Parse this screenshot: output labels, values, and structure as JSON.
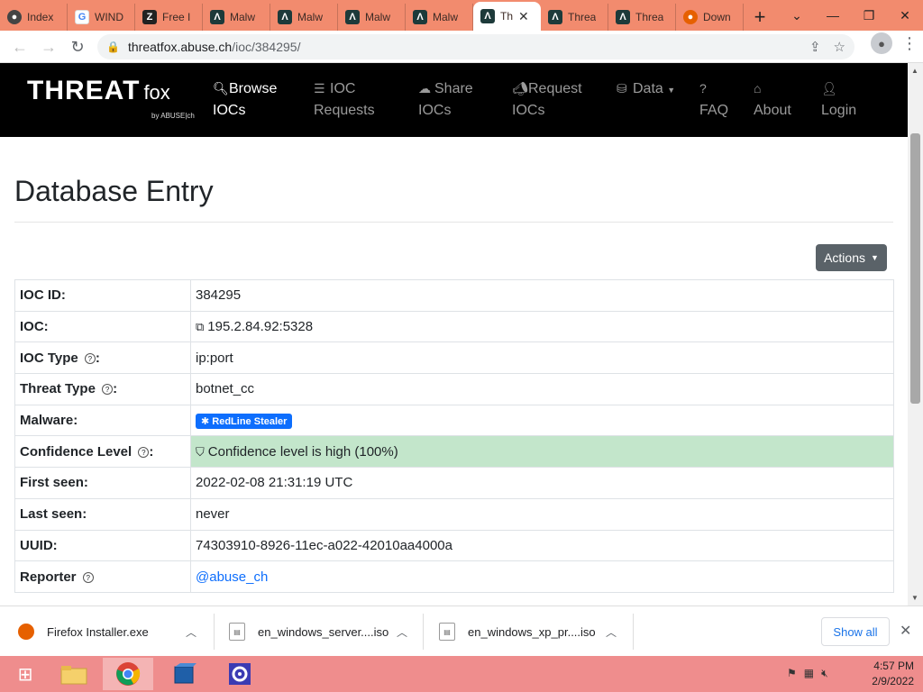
{
  "browser": {
    "tabs": [
      {
        "title": "Index",
        "icon": "github-icon",
        "active": false
      },
      {
        "title": "WIND",
        "icon": "google-icon",
        "active": false
      },
      {
        "title": "Free I",
        "icon": "zone-icon",
        "active": false
      },
      {
        "title": "Malw",
        "icon": "anyrun-icon",
        "active": false
      },
      {
        "title": "Malw",
        "icon": "anyrun-icon",
        "active": false
      },
      {
        "title": "Malw",
        "icon": "anyrun-icon",
        "active": false
      },
      {
        "title": "Malw",
        "icon": "anyrun-icon",
        "active": false
      },
      {
        "title": "Th",
        "icon": "anyrun-icon",
        "active": true
      },
      {
        "title": "Threa",
        "icon": "anyrun-icon",
        "active": false
      },
      {
        "title": "Threa",
        "icon": "anyrun-icon",
        "active": false
      },
      {
        "title": "Down",
        "icon": "firefox-icon",
        "active": false
      }
    ],
    "url_host": "threatfox.abuse.ch",
    "url_path": "/ioc/384295/"
  },
  "site": {
    "logo_main": "THREAT",
    "logo_sub": "fox",
    "logo_by": "by ABUSE|ch",
    "nav": [
      {
        "line1": "Browse",
        "line2": "IOCs",
        "icon": "search-icon",
        "active": true
      },
      {
        "line1": "IOC",
        "line2": "Requests",
        "icon": "list-icon",
        "active": false
      },
      {
        "line1": "Share",
        "line2": "IOCs",
        "icon": "cloud-upload-icon",
        "active": false
      },
      {
        "line1": "Request",
        "line2": "IOCs",
        "icon": "megaphone-icon",
        "active": false
      },
      {
        "line1": "Data",
        "line2": "",
        "icon": "database-icon",
        "active": false
      },
      {
        "line1": "",
        "line2": "FAQ",
        "icon": "question-circle-icon",
        "active": false
      },
      {
        "line1": "",
        "line2": "About",
        "icon": "building-icon",
        "active": false
      },
      {
        "line1": "",
        "line2": "Login",
        "icon": "user-icon",
        "active": false
      }
    ]
  },
  "page": {
    "title": "Database Entry",
    "actions_label": "Actions",
    "rows": [
      {
        "key": "IOC ID:",
        "value": "384295"
      },
      {
        "key": "IOC:",
        "value": "195.2.84.92:5328"
      },
      {
        "key": "IOC Type",
        "value": "ip:port"
      },
      {
        "key": "Threat Type",
        "value": "botnet_cc"
      },
      {
        "key": "Malware:",
        "value": "RedLine Stealer"
      },
      {
        "key": "Confidence Level",
        "value": "Confidence level is high (100%)"
      },
      {
        "key": "First seen:",
        "value": "2022-02-08 21:31:19 UTC"
      },
      {
        "key": "Last seen:",
        "value": "never"
      },
      {
        "key": "UUID:",
        "value": "74303910-8926-11ec-a022-42010aa4000a"
      },
      {
        "key": "Reporter",
        "value": "@abuse_ch"
      }
    ],
    "help_suffix": ":"
  },
  "downloads": {
    "items": [
      {
        "name": "Firefox Installer.exe"
      },
      {
        "name": "en_windows_server....iso"
      },
      {
        "name": "en_windows_xp_pr....iso"
      }
    ],
    "show_all": "Show all"
  },
  "taskbar": {
    "time": "4:57 PM",
    "date": "2/9/2022"
  }
}
